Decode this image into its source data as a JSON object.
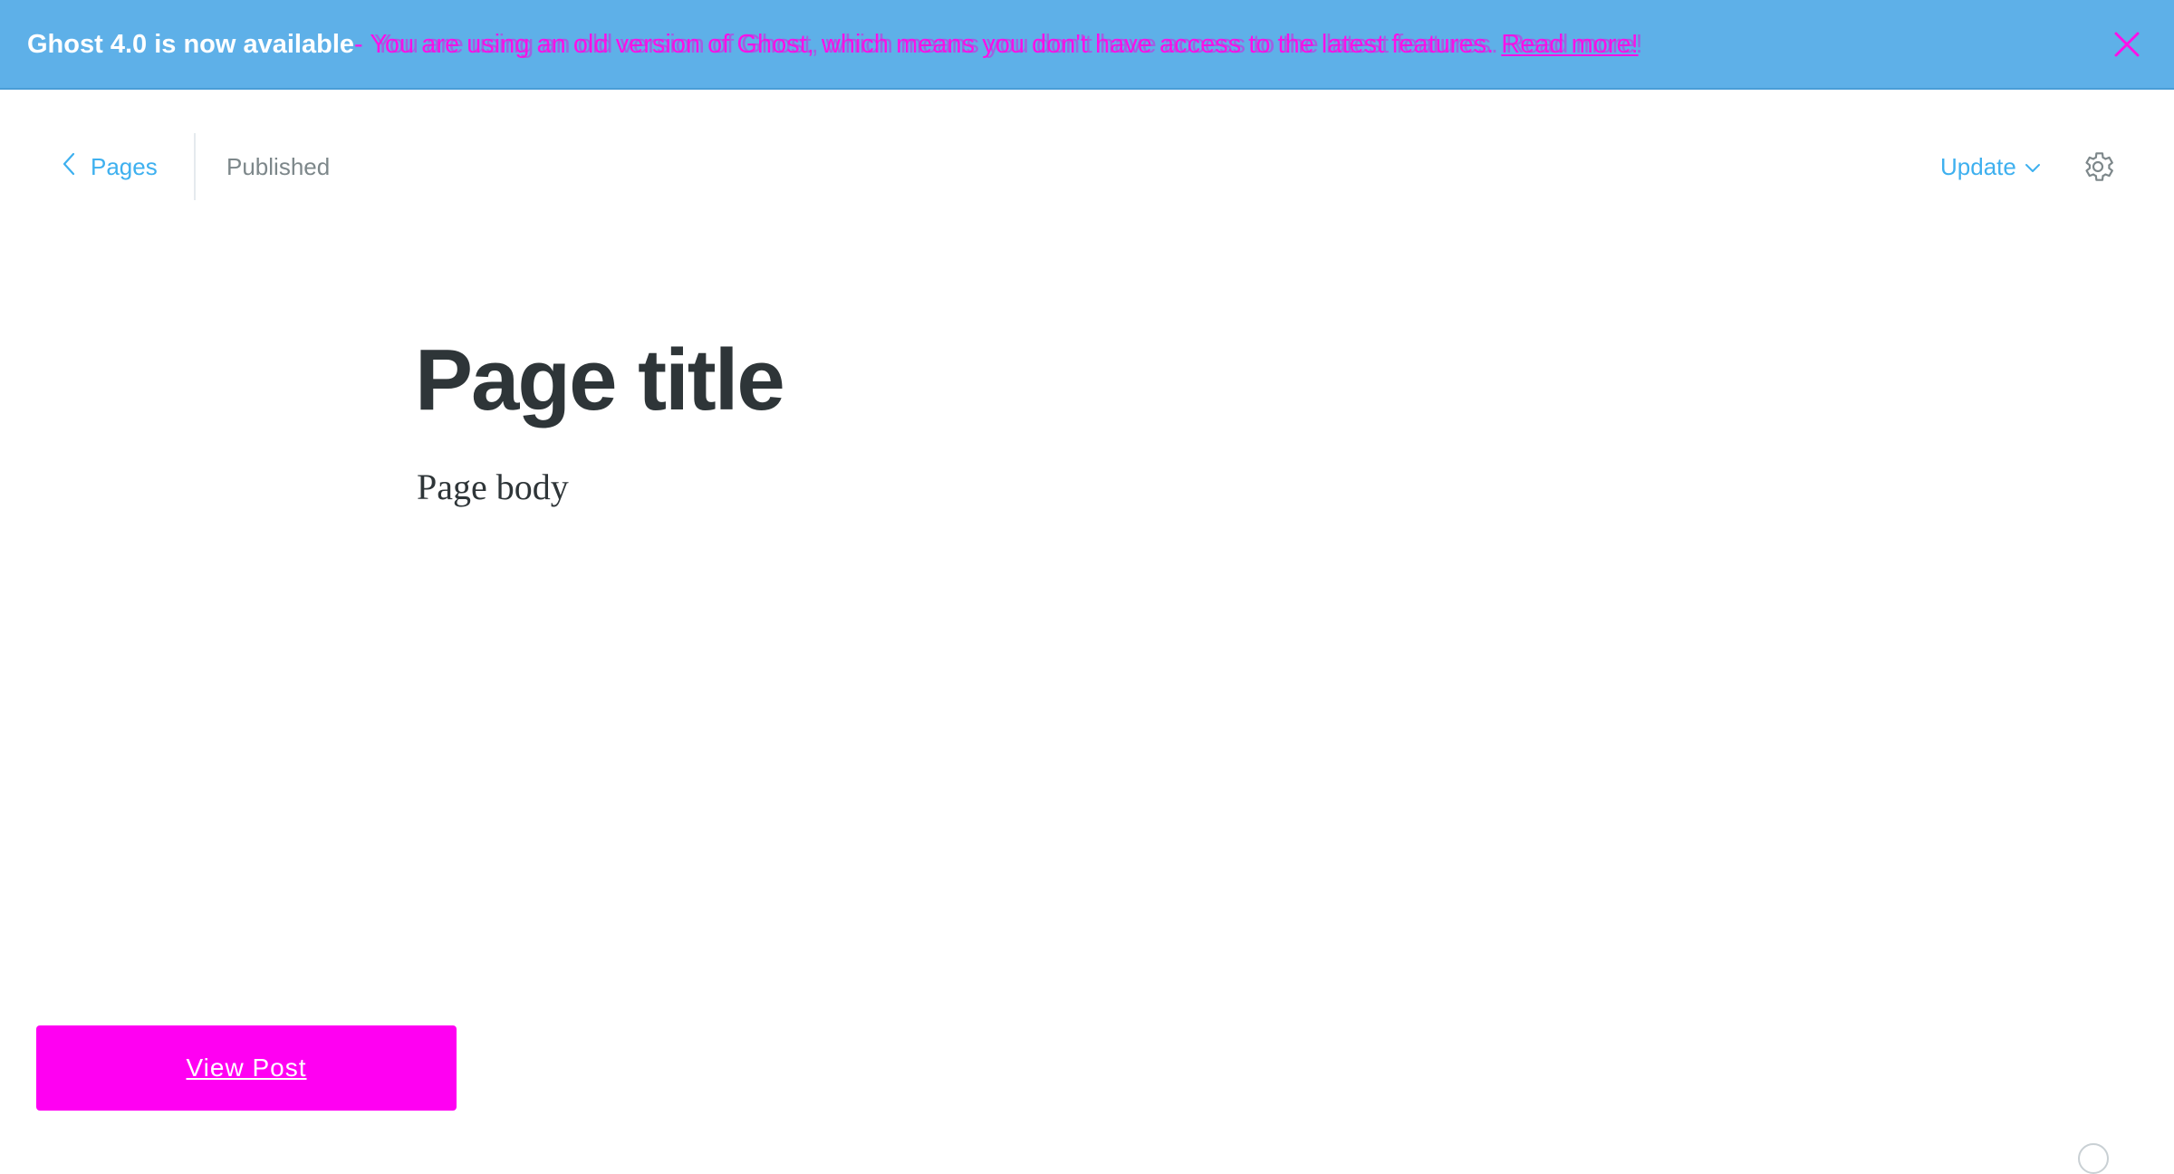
{
  "banner": {
    "title": "Ghost 4.0 is now available",
    "message": " - You are using an old version of Ghost, which means you don't have access to the latest features. ",
    "link_label": "Read more!",
    "ghost_message": "You are using an old version of Ghost, which means you don't have access to the latest features. Read more!",
    "close_icon": "close-icon",
    "background_color": "#5eb0e8",
    "message_color": "#ff10e8"
  },
  "header": {
    "back_label": "Pages",
    "back_icon": "chevron-left-icon",
    "status": "Published",
    "update_label": "Update",
    "update_icon": "chevron-down-icon",
    "settings_icon": "gear-icon",
    "accent_color": "#3eb0ef"
  },
  "editor": {
    "title": "Page title",
    "body": "Page body"
  },
  "view_post": {
    "label": "View Post",
    "background_color": "#ff00f2"
  },
  "help": {
    "icon": "help-icon"
  }
}
